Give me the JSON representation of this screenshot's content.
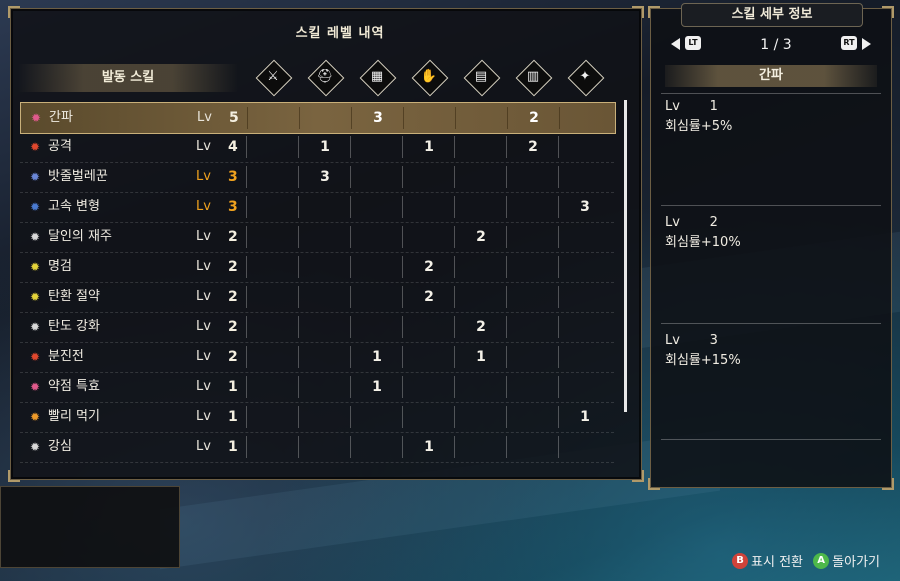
{
  "panel": {
    "title": "스킬 레벨 내역",
    "left_header": "발동 스킬",
    "equipment_columns": [
      {
        "name": "weapon-icon",
        "glyph": "⚔"
      },
      {
        "name": "helm-icon",
        "glyph": "⛑"
      },
      {
        "name": "chest-icon",
        "glyph": "▦"
      },
      {
        "name": "arms-icon",
        "glyph": "✋"
      },
      {
        "name": "waist-icon",
        "glyph": "▤"
      },
      {
        "name": "legs-icon",
        "glyph": "▥"
      },
      {
        "name": "talisman-icon",
        "glyph": "✦"
      }
    ]
  },
  "skills": [
    {
      "name": "간파",
      "lv_label": "Lv",
      "lv": "5",
      "lv_color": "white",
      "icon_color": "#e05a8c",
      "cells": [
        "",
        "",
        "3",
        "",
        "",
        "2",
        ""
      ]
    },
    {
      "name": "공격",
      "lv_label": "Lv",
      "lv": "4",
      "lv_color": "white",
      "icon_color": "#e0482e",
      "cells": [
        "",
        "1",
        "",
        "1",
        "",
        "2",
        ""
      ]
    },
    {
      "name": "밧줄벌레꾼",
      "lv_label": "Lv",
      "lv": "3",
      "lv_color": "orange",
      "icon_color": "#6a86d6",
      "cells": [
        "",
        "3",
        "",
        "",
        "",
        "",
        ""
      ]
    },
    {
      "name": "고속 변형",
      "lv_label": "Lv",
      "lv": "3",
      "lv_color": "orange",
      "icon_color": "#4a7ad0",
      "cells": [
        "",
        "",
        "",
        "",
        "",
        "",
        "3"
      ]
    },
    {
      "name": "달인의 재주",
      "lv_label": "Lv",
      "lv": "2",
      "lv_color": "white",
      "icon_color": "#d8d8d8",
      "cells": [
        "",
        "",
        "",
        "",
        "2",
        "",
        ""
      ]
    },
    {
      "name": "명검",
      "lv_label": "Lv",
      "lv": "2",
      "lv_color": "white",
      "icon_color": "#e3d33a",
      "cells": [
        "",
        "",
        "",
        "2",
        "",
        "",
        ""
      ]
    },
    {
      "name": "탄환 절약",
      "lv_label": "Lv",
      "lv": "2",
      "lv_color": "white",
      "icon_color": "#e3d33a",
      "cells": [
        "",
        "",
        "",
        "2",
        "",
        "",
        ""
      ]
    },
    {
      "name": "탄도 강화",
      "lv_label": "Lv",
      "lv": "2",
      "lv_color": "white",
      "icon_color": "#d8d8d8",
      "cells": [
        "",
        "",
        "",
        "",
        "2",
        "",
        ""
      ]
    },
    {
      "name": "분진전",
      "lv_label": "Lv",
      "lv": "2",
      "lv_color": "white",
      "icon_color": "#e0482e",
      "cells": [
        "",
        "",
        "1",
        "",
        "1",
        "",
        ""
      ]
    },
    {
      "name": "약점 특효",
      "lv_label": "Lv",
      "lv": "1",
      "lv_color": "white",
      "icon_color": "#e05a8c",
      "cells": [
        "",
        "",
        "1",
        "",
        "",
        "",
        ""
      ]
    },
    {
      "name": "빨리 먹기",
      "lv_label": "Lv",
      "lv": "1",
      "lv_color": "white",
      "icon_color": "#ee9a2a",
      "cells": [
        "",
        "",
        "",
        "",
        "",
        "",
        "1"
      ]
    },
    {
      "name": "강심",
      "lv_label": "Lv",
      "lv": "1",
      "lv_color": "white",
      "icon_color": "#d8d8d8",
      "cells": [
        "",
        "",
        "",
        "1",
        "",
        "",
        ""
      ]
    }
  ],
  "detail": {
    "title": "스킬 세부 정보",
    "lt": "LT",
    "rt": "RT",
    "page": "1 / 3",
    "skill_name": "간파",
    "levels": [
      {
        "label": "Lv",
        "num": "1",
        "desc": "회심률+5%"
      },
      {
        "label": "Lv",
        "num": "2",
        "desc": "회심률+10%"
      },
      {
        "label": "Lv",
        "num": "3",
        "desc": "회심률+15%"
      }
    ]
  },
  "footer": {
    "b_key": "B",
    "b_label": "표시 전환",
    "a_key": "A",
    "a_label": "돌아가기"
  }
}
